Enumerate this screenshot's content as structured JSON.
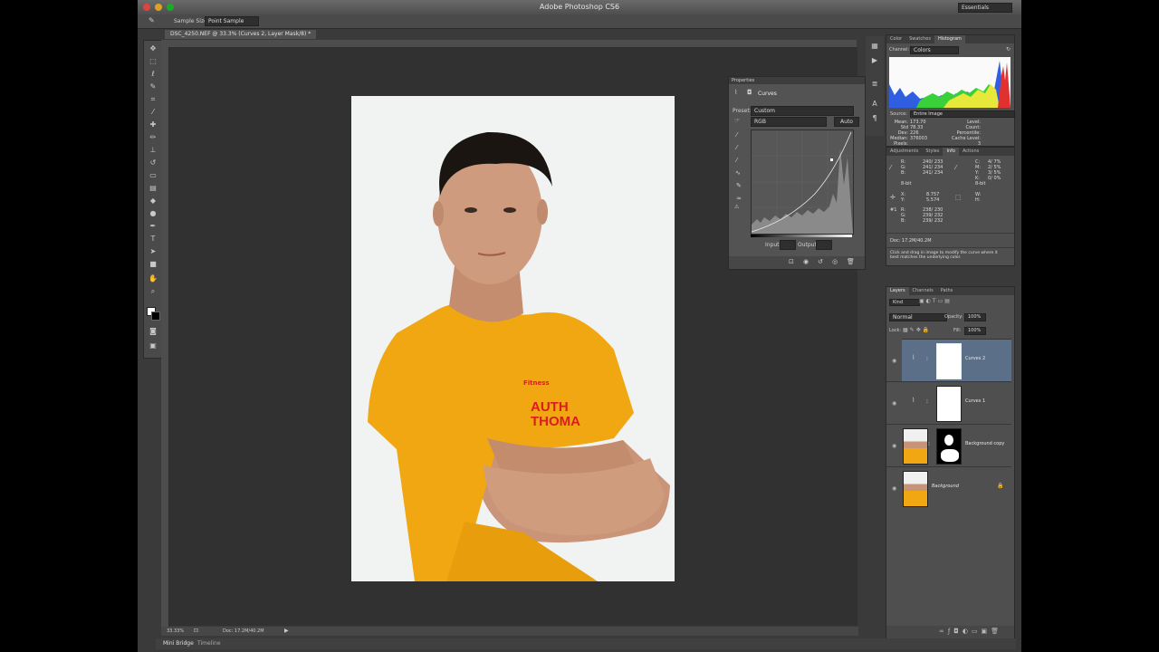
{
  "window": {
    "title": "Adobe Photoshop CS6",
    "workspace": "Essentials"
  },
  "options_bar": {
    "sample_size_label": "Sample Size:",
    "sample_size_value": "Point Sample"
  },
  "document": {
    "tab": "DSC_4250.NEF @ 33.3% (Curves 2, Layer Mask/8) *",
    "zoom": "33.33%",
    "doc_size": "Doc: 17.2M/40.2M"
  },
  "bottom_tabs": [
    "Mini Bridge",
    "Timeline"
  ],
  "photo": {
    "shirt_logo": "Fitness",
    "shirt_text_1": "AUTH",
    "shirt_text_2": "THOMA"
  },
  "properties": {
    "title": "Properties",
    "adjustment": "Curves",
    "preset_label": "Preset:",
    "preset_value": "Custom",
    "channel_value": "RGB",
    "auto_label": "Auto",
    "input_label": "Input:",
    "output_label": "Output:"
  },
  "histogram": {
    "tabs": [
      "Color",
      "Swatches",
      "Histogram"
    ],
    "active_tab": "Histogram",
    "channel_label": "Channel:",
    "channel_value": "Colors",
    "source_label": "Source:",
    "source_value": "Entire Image",
    "stats": [
      {
        "label": "Mean:",
        "value": "173.70"
      },
      {
        "label": "Std Dev:",
        "value": "78.33"
      },
      {
        "label": "Median:",
        "value": "226"
      },
      {
        "label": "Pixels:",
        "value": "376003"
      }
    ],
    "stats_right": [
      "Level:",
      "Count:",
      "Percentile:",
      "Cache Level: 3"
    ]
  },
  "info": {
    "tabs": [
      "Adjustments",
      "Styles",
      "Info",
      "Actions"
    ],
    "active_tab": "Info",
    "rgb_labels": [
      "R:",
      "G:",
      "B:"
    ],
    "rgb_values": [
      "240/ 233",
      "241/ 234",
      "241/ 234"
    ],
    "cmyk_labels": [
      "C:",
      "M:",
      "Y:",
      "K:"
    ],
    "cmyk_values": [
      "4/ 7%",
      "2/ 5%",
      "3/ 5%",
      "0/ 0%"
    ],
    "bit_left": "8-bit",
    "bit_right": "8-bit",
    "x_label": "X:",
    "x_value": "8.757",
    "y_label": "Y:",
    "y_value": "5.574",
    "w_label": "W:",
    "h_label": "H:",
    "sample_label": "#1",
    "sample_values": [
      "238/ 230",
      "239/ 232",
      "239/ 232"
    ],
    "doc_line": "Doc: 17.2M/40.2M",
    "hint_1": "Click and drag in image to modify the curve where it",
    "hint_2": "best matches the underlying color."
  },
  "layers": {
    "tabs": [
      "Layers",
      "Channels",
      "Paths"
    ],
    "kind_value": "Kind",
    "blend_mode": "Normal",
    "opacity_label": "Opacity:",
    "opacity_value": "100%",
    "lock_label": "Lock:",
    "fill_label": "Fill:",
    "fill_value": "100%",
    "items": [
      {
        "name": "Curves 2",
        "selected": true
      },
      {
        "name": "Curves 1",
        "selected": false
      },
      {
        "name": "Background copy",
        "selected": false
      },
      {
        "name": "Background",
        "selected": false
      }
    ]
  },
  "colors": {
    "accent_selected": "#5b7088",
    "shirt": "#f2a50f",
    "histogram_blue": "#2f5fe0",
    "histogram_red": "#e03030"
  }
}
